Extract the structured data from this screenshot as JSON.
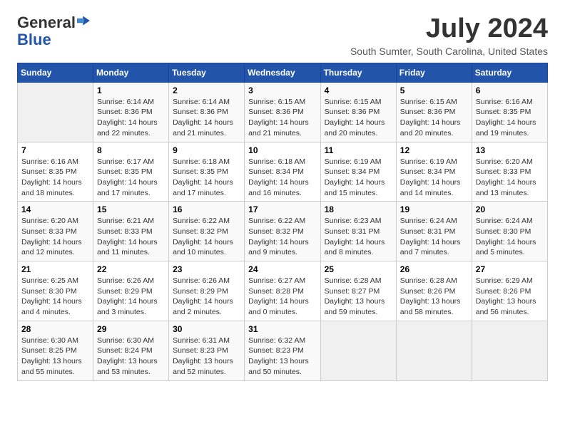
{
  "header": {
    "logo_general": "General",
    "logo_blue": "Blue",
    "month_title": "July 2024",
    "location": "South Sumter, South Carolina, United States"
  },
  "days_of_week": [
    "Sunday",
    "Monday",
    "Tuesday",
    "Wednesday",
    "Thursday",
    "Friday",
    "Saturday"
  ],
  "weeks": [
    [
      {
        "day": "",
        "info": ""
      },
      {
        "day": "1",
        "info": "Sunrise: 6:14 AM\nSunset: 8:36 PM\nDaylight: 14 hours\nand 22 minutes."
      },
      {
        "day": "2",
        "info": "Sunrise: 6:14 AM\nSunset: 8:36 PM\nDaylight: 14 hours\nand 21 minutes."
      },
      {
        "day": "3",
        "info": "Sunrise: 6:15 AM\nSunset: 8:36 PM\nDaylight: 14 hours\nand 21 minutes."
      },
      {
        "day": "4",
        "info": "Sunrise: 6:15 AM\nSunset: 8:36 PM\nDaylight: 14 hours\nand 20 minutes."
      },
      {
        "day": "5",
        "info": "Sunrise: 6:15 AM\nSunset: 8:36 PM\nDaylight: 14 hours\nand 20 minutes."
      },
      {
        "day": "6",
        "info": "Sunrise: 6:16 AM\nSunset: 8:35 PM\nDaylight: 14 hours\nand 19 minutes."
      }
    ],
    [
      {
        "day": "7",
        "info": "Sunrise: 6:16 AM\nSunset: 8:35 PM\nDaylight: 14 hours\nand 18 minutes."
      },
      {
        "day": "8",
        "info": "Sunrise: 6:17 AM\nSunset: 8:35 PM\nDaylight: 14 hours\nand 17 minutes."
      },
      {
        "day": "9",
        "info": "Sunrise: 6:18 AM\nSunset: 8:35 PM\nDaylight: 14 hours\nand 17 minutes."
      },
      {
        "day": "10",
        "info": "Sunrise: 6:18 AM\nSunset: 8:34 PM\nDaylight: 14 hours\nand 16 minutes."
      },
      {
        "day": "11",
        "info": "Sunrise: 6:19 AM\nSunset: 8:34 PM\nDaylight: 14 hours\nand 15 minutes."
      },
      {
        "day": "12",
        "info": "Sunrise: 6:19 AM\nSunset: 8:34 PM\nDaylight: 14 hours\nand 14 minutes."
      },
      {
        "day": "13",
        "info": "Sunrise: 6:20 AM\nSunset: 8:33 PM\nDaylight: 14 hours\nand 13 minutes."
      }
    ],
    [
      {
        "day": "14",
        "info": "Sunrise: 6:20 AM\nSunset: 8:33 PM\nDaylight: 14 hours\nand 12 minutes."
      },
      {
        "day": "15",
        "info": "Sunrise: 6:21 AM\nSunset: 8:33 PM\nDaylight: 14 hours\nand 11 minutes."
      },
      {
        "day": "16",
        "info": "Sunrise: 6:22 AM\nSunset: 8:32 PM\nDaylight: 14 hours\nand 10 minutes."
      },
      {
        "day": "17",
        "info": "Sunrise: 6:22 AM\nSunset: 8:32 PM\nDaylight: 14 hours\nand 9 minutes."
      },
      {
        "day": "18",
        "info": "Sunrise: 6:23 AM\nSunset: 8:31 PM\nDaylight: 14 hours\nand 8 minutes."
      },
      {
        "day": "19",
        "info": "Sunrise: 6:24 AM\nSunset: 8:31 PM\nDaylight: 14 hours\nand 7 minutes."
      },
      {
        "day": "20",
        "info": "Sunrise: 6:24 AM\nSunset: 8:30 PM\nDaylight: 14 hours\nand 5 minutes."
      }
    ],
    [
      {
        "day": "21",
        "info": "Sunrise: 6:25 AM\nSunset: 8:30 PM\nDaylight: 14 hours\nand 4 minutes."
      },
      {
        "day": "22",
        "info": "Sunrise: 6:26 AM\nSunset: 8:29 PM\nDaylight: 14 hours\nand 3 minutes."
      },
      {
        "day": "23",
        "info": "Sunrise: 6:26 AM\nSunset: 8:29 PM\nDaylight: 14 hours\nand 2 minutes."
      },
      {
        "day": "24",
        "info": "Sunrise: 6:27 AM\nSunset: 8:28 PM\nDaylight: 14 hours\nand 0 minutes."
      },
      {
        "day": "25",
        "info": "Sunrise: 6:28 AM\nSunset: 8:27 PM\nDaylight: 13 hours\nand 59 minutes."
      },
      {
        "day": "26",
        "info": "Sunrise: 6:28 AM\nSunset: 8:26 PM\nDaylight: 13 hours\nand 58 minutes."
      },
      {
        "day": "27",
        "info": "Sunrise: 6:29 AM\nSunset: 8:26 PM\nDaylight: 13 hours\nand 56 minutes."
      }
    ],
    [
      {
        "day": "28",
        "info": "Sunrise: 6:30 AM\nSunset: 8:25 PM\nDaylight: 13 hours\nand 55 minutes."
      },
      {
        "day": "29",
        "info": "Sunrise: 6:30 AM\nSunset: 8:24 PM\nDaylight: 13 hours\nand 53 minutes."
      },
      {
        "day": "30",
        "info": "Sunrise: 6:31 AM\nSunset: 8:23 PM\nDaylight: 13 hours\nand 52 minutes."
      },
      {
        "day": "31",
        "info": "Sunrise: 6:32 AM\nSunset: 8:23 PM\nDaylight: 13 hours\nand 50 minutes."
      },
      {
        "day": "",
        "info": ""
      },
      {
        "day": "",
        "info": ""
      },
      {
        "day": "",
        "info": ""
      }
    ]
  ]
}
